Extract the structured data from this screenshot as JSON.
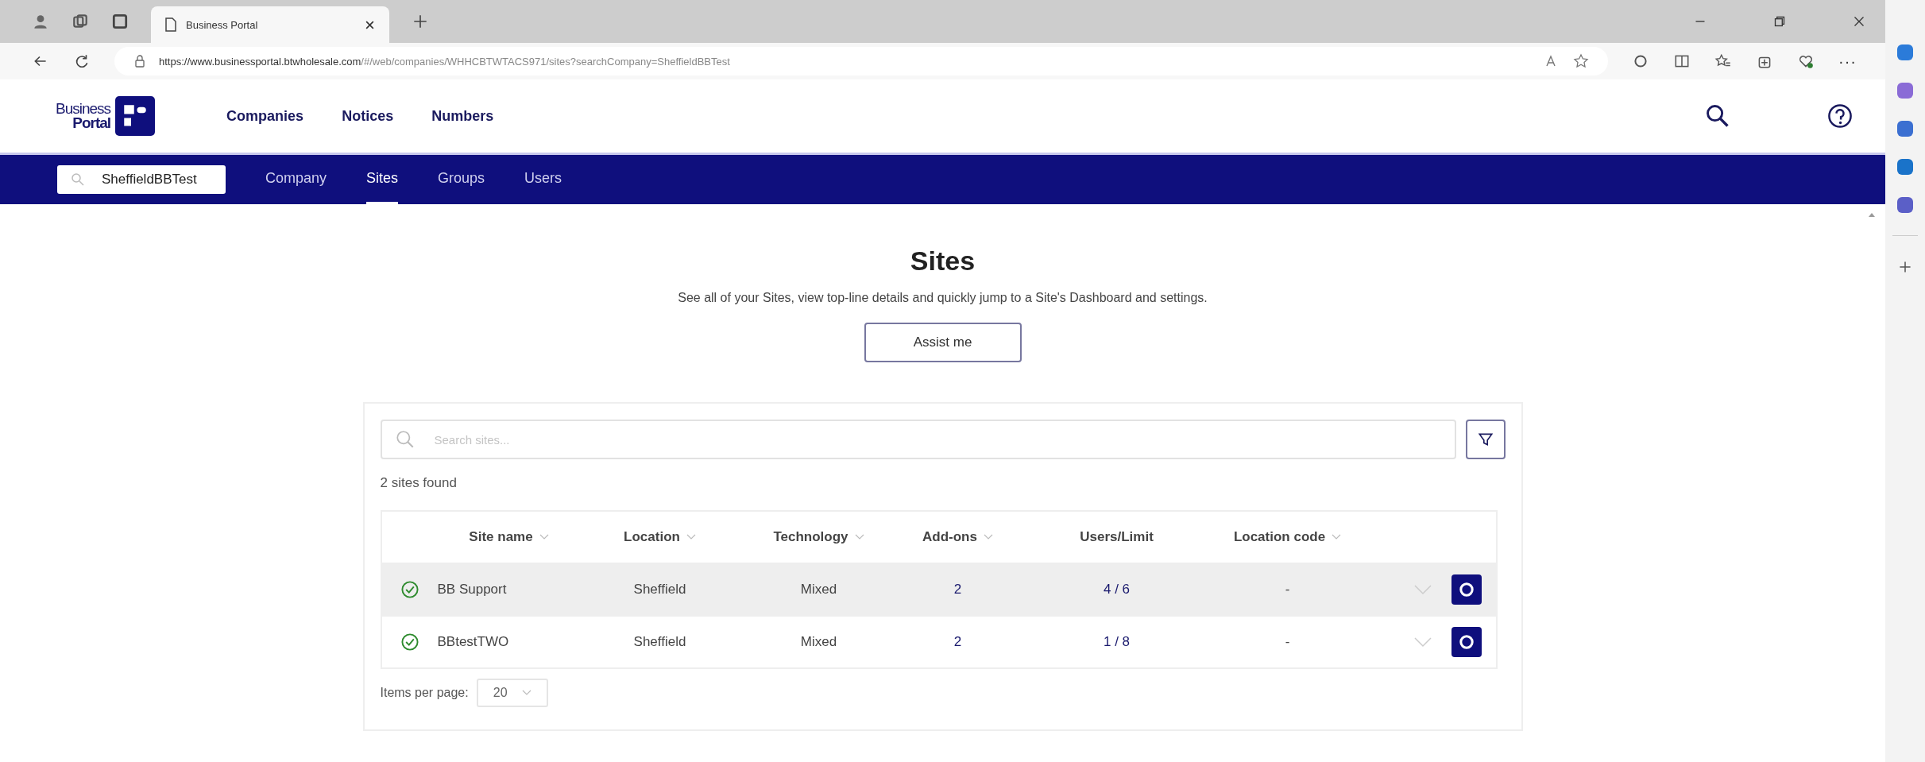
{
  "browser": {
    "tabs": [
      {
        "title": "Business Portal",
        "selected": true
      }
    ],
    "url_host": "https://www.businessportal.btwholesale.com",
    "url_path": "/#/web/companies/WHHCBTWTACS971/sites?searchCompany=SheffieldBBTest",
    "more": "···"
  },
  "header": {
    "logo_line1": "Business",
    "logo_line2": "Portal",
    "nav": [
      {
        "label": "Companies"
      },
      {
        "label": "Notices"
      },
      {
        "label": "Numbers"
      }
    ]
  },
  "subnav": {
    "company_search": "SheffieldBBTest",
    "tabs": [
      {
        "label": "Company",
        "selected": false
      },
      {
        "label": "Sites",
        "selected": true
      },
      {
        "label": "Groups",
        "selected": false
      },
      {
        "label": "Users",
        "selected": false
      }
    ]
  },
  "page": {
    "title": "Sites",
    "description": "See all of your Sites, view top-line details and quickly jump to a Site's Dashboard and settings.",
    "assist_button": "Assist me"
  },
  "card": {
    "search_placeholder": "Search sites...",
    "results": "2 sites found",
    "columns": [
      {
        "label": "Site name",
        "sortable": true
      },
      {
        "label": "Location",
        "sortable": true
      },
      {
        "label": "Technology",
        "sortable": true
      },
      {
        "label": "Add-ons",
        "sortable": true
      },
      {
        "label": "Users/Limit",
        "sortable": false
      },
      {
        "label": "Location code",
        "sortable": true
      }
    ],
    "rows": [
      {
        "selected": true,
        "cells": [
          "BB Support",
          "Sheffield",
          "Mixed",
          "2",
          "4 / 6",
          "-"
        ]
      },
      {
        "selected": false,
        "cells": [
          "BBtestTWO",
          "Sheffield",
          "Mixed",
          "2",
          "1 / 8",
          "-"
        ]
      }
    ],
    "items_per_page_label": "Items per page:",
    "items_per_page": "20"
  }
}
